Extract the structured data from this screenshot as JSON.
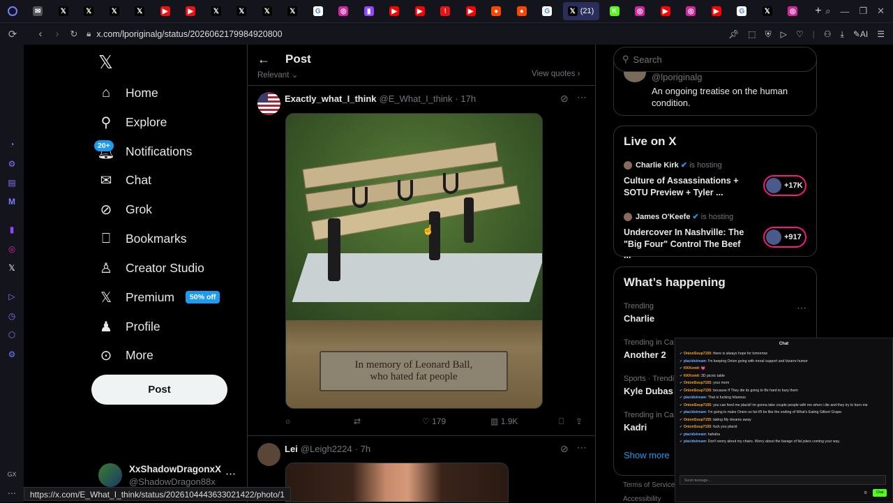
{
  "browser": {
    "tabs": [
      {
        "icon": "mail-icon",
        "glyph": "✉",
        "color": "#555"
      },
      {
        "icon": "x-icon",
        "glyph": "𝕏",
        "color": "#000"
      },
      {
        "icon": "x-icon",
        "glyph": "𝕏",
        "color": "#000"
      },
      {
        "icon": "x-icon",
        "glyph": "𝕏",
        "color": "#000"
      },
      {
        "icon": "x-icon",
        "glyph": "𝕏",
        "color": "#000"
      },
      {
        "icon": "play-icon",
        "glyph": "▶",
        "color": "#e11"
      },
      {
        "icon": "play-icon",
        "glyph": "▶",
        "color": "#e11"
      },
      {
        "icon": "x-icon",
        "glyph": "𝕏",
        "color": "#000"
      },
      {
        "icon": "x-icon",
        "glyph": "𝕏",
        "color": "#000"
      },
      {
        "icon": "x-icon",
        "glyph": "𝕏",
        "color": "#000"
      },
      {
        "icon": "x-icon",
        "glyph": "𝕏",
        "color": "#000"
      },
      {
        "icon": "google-icon",
        "glyph": "G",
        "color": "#fff"
      },
      {
        "icon": "instagram-icon",
        "glyph": "◎",
        "color": "#d6249f"
      },
      {
        "icon": "twitch-icon",
        "glyph": "▮",
        "color": "#9146ff"
      },
      {
        "icon": "youtube-icon",
        "glyph": "▶",
        "color": "#f00"
      },
      {
        "icon": "youtube-icon",
        "glyph": "▶",
        "color": "#f00"
      },
      {
        "icon": "alert-icon",
        "glyph": "!",
        "color": "#e11"
      },
      {
        "icon": "youtube-icon",
        "glyph": "▶",
        "color": "#f00"
      },
      {
        "icon": "reddit-icon",
        "glyph": "●",
        "color": "#ff4500"
      },
      {
        "icon": "reddit-icon",
        "glyph": "●",
        "color": "#ff4500"
      },
      {
        "icon": "google-icon",
        "glyph": "G",
        "color": "#fff"
      }
    ],
    "active_tab": {
      "label": "(21)"
    },
    "tabs_after": [
      {
        "icon": "kick-icon",
        "glyph": "K",
        "color": "#53fc18"
      },
      {
        "icon": "instagram-icon",
        "glyph": "◎",
        "color": "#d6249f"
      },
      {
        "icon": "youtube-icon",
        "glyph": "▶",
        "color": "#f00"
      },
      {
        "icon": "instagram-icon",
        "glyph": "◎",
        "color": "#d6249f"
      },
      {
        "icon": "youtube-icon",
        "glyph": "▶",
        "color": "#f00"
      },
      {
        "icon": "google-icon",
        "glyph": "G",
        "color": "#fff"
      },
      {
        "icon": "x-icon",
        "glyph": "𝕏",
        "color": "#000"
      },
      {
        "icon": "instagram-icon",
        "glyph": "◎",
        "color": "#d6249f"
      }
    ],
    "url": "x.com/lporiginalg/status/2026062179984920800",
    "ai_label": "AI",
    "status_url": "https://x.com/E_What_I_think/status/2026104443633021422/photo/1"
  },
  "nav": {
    "home": "Home",
    "explore": "Explore",
    "notifications": "Notifications",
    "notifications_badge": "20+",
    "chat": "Chat",
    "grok": "Grok",
    "bookmarks": "Bookmarks",
    "creator_studio": "Creator Studio",
    "premium": "Premium",
    "premium_badge": "50% off",
    "profile": "Profile",
    "more": "More",
    "post_button": "Post",
    "account_name": "XxShadowDragonxX",
    "account_handle": "@ShadowDragon88x"
  },
  "center": {
    "title": "Post",
    "sort_label": "Relevant ⌄",
    "view_quotes": "View quotes ›",
    "tweet1": {
      "name": "Exactly_what_I_think",
      "handle": "@E_What_I_think",
      "time": "· 17h",
      "plaque_line1": "In memory of Leonard Ball,",
      "plaque_line2": "who hated fat people",
      "likes": "179",
      "views": "1.9K"
    },
    "tweet2": {
      "name": "Lei",
      "handle": "@Leigh2224",
      "time": "· 7h"
    }
  },
  "right": {
    "search_placeholder": "Search",
    "bio_handle": "@lporiginalg",
    "bio_text": "An ongoing treatise on the human condition.",
    "live_title": "Live on X",
    "live": [
      {
        "host": "Charlie Kirk",
        "hosting": "is hosting",
        "title": "Culture of Assassinations + SOTU Preview + Tyler ...",
        "count": "+17K"
      },
      {
        "host": "James O'Keefe",
        "hosting": "is hosting",
        "title": "Undercover In Nashville: The \"Big Four\" Control The Beef ...",
        "count": "+917"
      }
    ],
    "happening_title": "What’s happening",
    "trends": [
      {
        "context": "Trending",
        "name": "Charlie"
      },
      {
        "context": "Trending in Ca",
        "name": "Another 2"
      },
      {
        "context": "Sports · Trendi",
        "name": "Kyle Dubas"
      },
      {
        "context": "Trending in Ca",
        "name": "Kadri"
      }
    ],
    "show_more": "Show more",
    "footer_terms": "Terms of Service",
    "footer_access": "Accessibility"
  },
  "chat": {
    "title": "Chat",
    "messages": [
      {
        "user": "OnionSoup7155",
        "color": "#f5a623",
        "text": "there is always hope for tomorrow"
      },
      {
        "user": "placidstream",
        "color": "#6fb2ff",
        "text": "I'm keeping Onion going with moral support and bizarre humor"
      },
      {
        "user": "KKKomit",
        "color": "#ff9c2a",
        "text": "💓"
      },
      {
        "user": "KKKomit",
        "color": "#ff9c2a",
        "text": "3D picnic table"
      },
      {
        "user": "OnionSoup7155",
        "color": "#f5a623",
        "text": "your mom"
      },
      {
        "user": "OnionSoup7155",
        "color": "#f5a623",
        "text": "because If They die its going to Be hard to bury them"
      },
      {
        "user": "placidstream",
        "color": "#6fb2ff",
        "text": "That is fucking hilarious"
      },
      {
        "user": "OnionSoup7155",
        "color": "#f5a623",
        "text": "you can feed me placid! im gonna take couple people with me when i die and they try to burn me"
      },
      {
        "user": "placidstream",
        "color": "#6fb2ff",
        "text": "I'm going to make Onion so fat it'll be like the ending of What's Eating Gilbert Grape."
      },
      {
        "user": "OnionSoup7155",
        "color": "#f5a623",
        "text": "taking My dreams away"
      },
      {
        "user": "OnionSoup7155",
        "color": "#f5a623",
        "text": "fuck you placid"
      },
      {
        "user": "placidstream",
        "color": "#6fb2ff",
        "text": "hahaha"
      },
      {
        "user": "placidstream",
        "color": "#6fb2ff",
        "text": "Don't worry about my chairs. Worry about the barage of fat jokes coming your way."
      }
    ],
    "input_placeholder": "Send message...",
    "send_label": "Chat"
  },
  "colors": {
    "accent": "#1d9bf0",
    "chat_send": "#53fc18"
  }
}
